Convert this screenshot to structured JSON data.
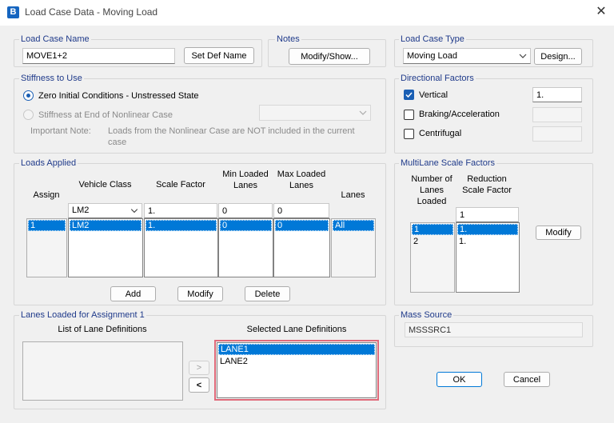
{
  "window": {
    "app_icon_letter": "B",
    "title": "Load Case Data - Moving Load",
    "close_glyph": "✕"
  },
  "load_case_name": {
    "label": "Load Case Name",
    "value": "MOVE1+2",
    "set_def_button": "Set Def Name"
  },
  "notes": {
    "label": "Notes",
    "button": "Modify/Show..."
  },
  "load_case_type": {
    "label": "Load Case Type",
    "value": "Moving Load",
    "design_button": "Design..."
  },
  "stiffness": {
    "label": "Stiffness to Use",
    "option_zero": "Zero Initial Conditions - Unstressed State",
    "option_nonlinear": "Stiffness at End of Nonlinear Case",
    "note_label": "Important Note:",
    "note_text_1": "Loads from the Nonlinear Case are NOT included in the current",
    "note_text_2": "case"
  },
  "directional_factors": {
    "label": "Directional Factors",
    "vertical_label": "Vertical",
    "vertical_value": "1.",
    "braking_label": "Braking/Acceleration",
    "centrifugal_label": "Centrifugal"
  },
  "loads_applied": {
    "label": "Loads Applied",
    "headers": {
      "assign": "Assign",
      "vehicle_class": "Vehicle Class",
      "scale_factor": "Scale Factor",
      "min_loaded_1": "Min Loaded",
      "min_loaded_2": "Lanes",
      "max_loaded_1": "Max Loaded",
      "max_loaded_2": "Lanes",
      "lanes": "Lanes"
    },
    "edit_row": {
      "vehicle_class": "LM2",
      "scale_factor": "1.",
      "min_lanes": "0",
      "max_lanes": "0"
    },
    "rows": [
      {
        "assign": "1",
        "vehicle_class": "LM2",
        "scale_factor": "1.",
        "min_lanes": "0",
        "max_lanes": "0",
        "lanes": "All"
      }
    ],
    "add_button": "Add",
    "modify_button": "Modify",
    "delete_button": "Delete"
  },
  "multilane": {
    "label": "MultiLane Scale Factors",
    "col1_header_1": "Number of",
    "col1_header_2": "Lanes",
    "col1_header_3": "Loaded",
    "col2_header_1": "Reduction",
    "col2_header_2": "Scale Factor",
    "edit_value": "1",
    "lanes_col": [
      "1",
      "2"
    ],
    "factor_col": [
      "1.",
      "1."
    ],
    "modify_button": "Modify"
  },
  "lanes_loaded": {
    "label": "Lanes Loaded for Assignment 1",
    "list_header": "List of Lane Definitions",
    "selected_header": "Selected Lane Definitions",
    "selected_items": [
      "LANE1",
      "LANE2"
    ],
    "add_arrow": ">",
    "remove_arrow": "<"
  },
  "mass_source": {
    "label": "Mass Source",
    "value": "MSSSRC1"
  },
  "ok_button": "OK",
  "cancel_button": "Cancel",
  "colors": {
    "group_label": "#1f3a8a",
    "selection": "#0078d7",
    "highlight_border": "#e06a7a"
  }
}
